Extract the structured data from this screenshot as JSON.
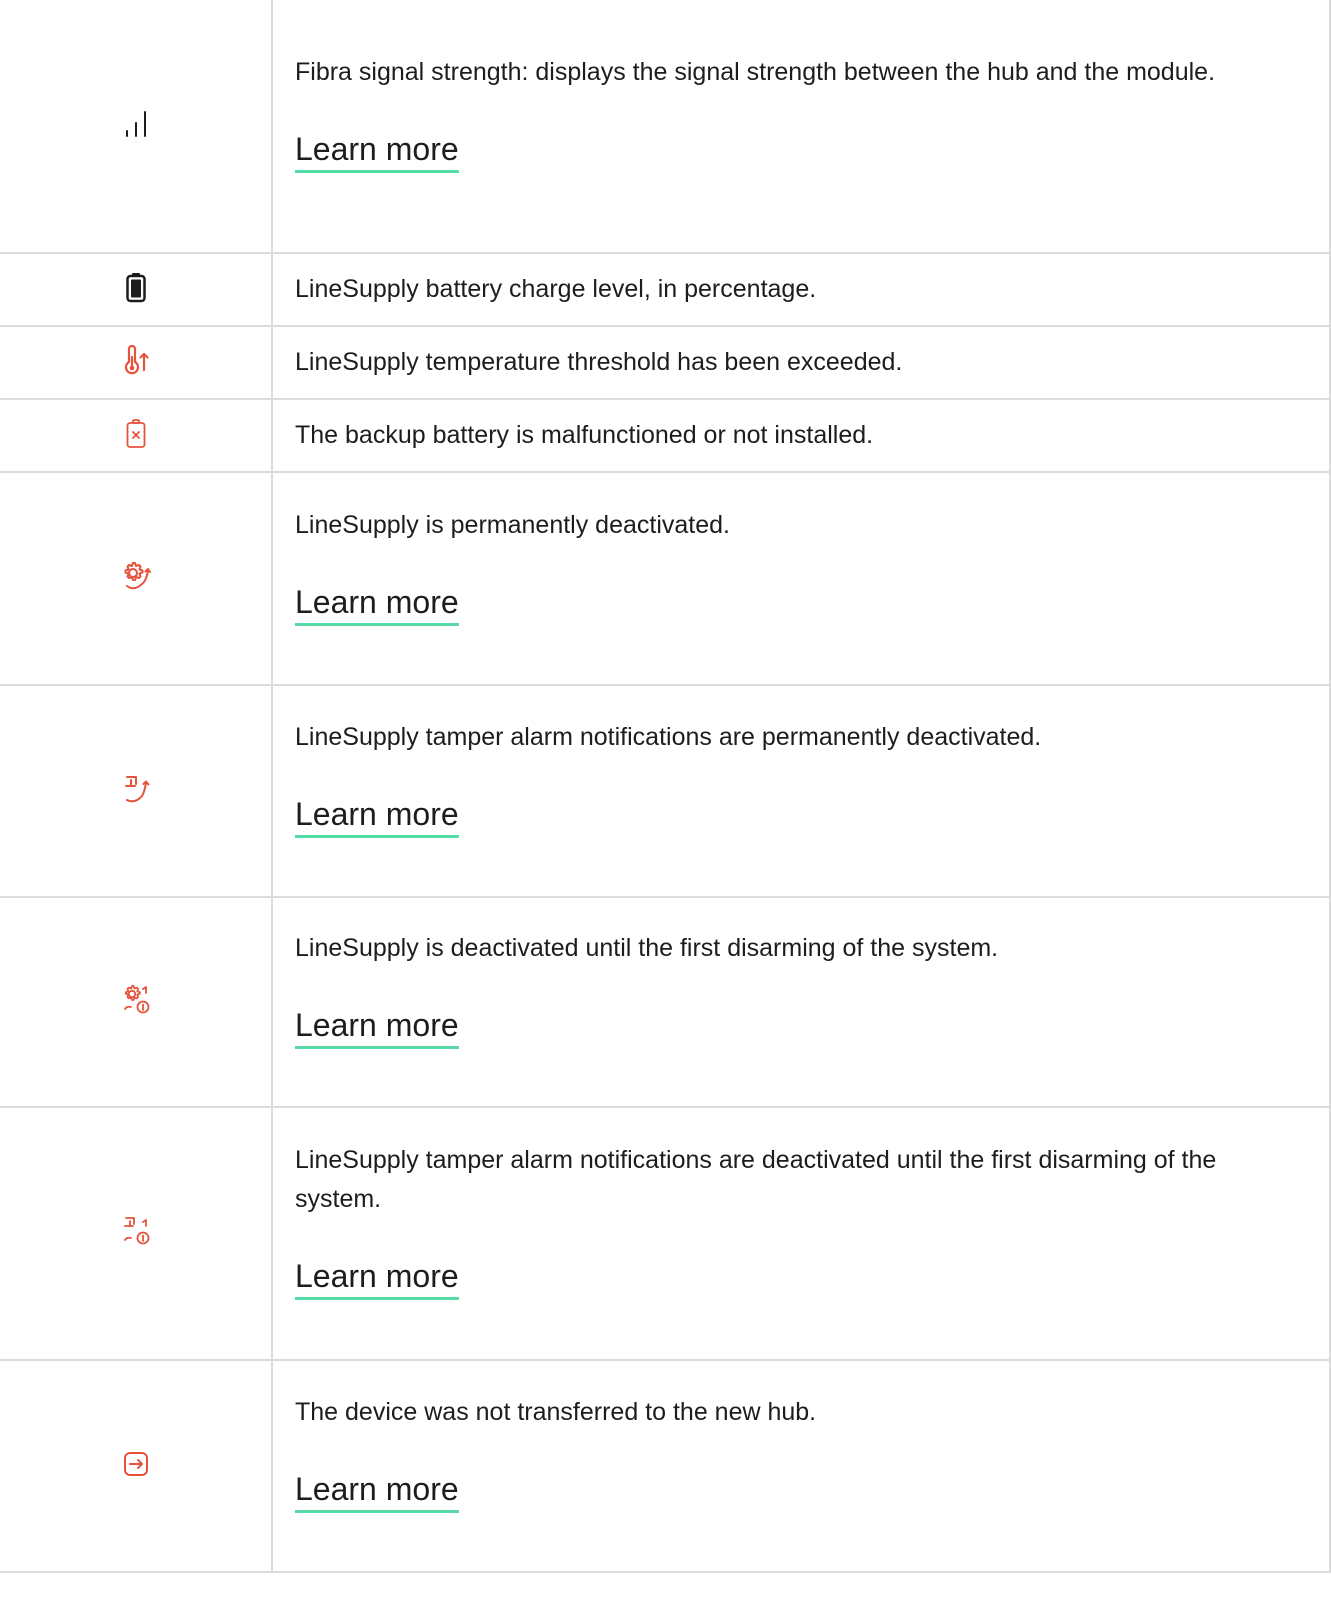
{
  "colors": {
    "accent_underline": "#56dba7",
    "warning_icon": "#e5533d",
    "neutral_icon": "#1d1d1d",
    "grid_line": "#dcdcdc"
  },
  "rows": [
    {
      "icon": "signal-strength-icon",
      "text": "Fibra signal strength: displays the signal strength between the hub and the module.",
      "link": "Learn more"
    },
    {
      "icon": "battery-charge-icon",
      "text": "LineSupply battery charge level, in percentage."
    },
    {
      "icon": "temperature-exceeded-icon",
      "text": "LineSupply temperature threshold has been exceeded."
    },
    {
      "icon": "battery-malfunction-icon",
      "text": "The backup battery is malfunctioned or not installed."
    },
    {
      "icon": "permanently-deactivated-icon",
      "text": "LineSupply is permanently deactivated.",
      "link": "Learn more"
    },
    {
      "icon": "tamper-permanently-deactivated-icon",
      "text": "LineSupply tamper alarm notifications are permanently deactivated.",
      "link": "Learn more"
    },
    {
      "icon": "deactivated-until-disarm-icon",
      "text": "LineSupply is deactivated until the first disarming of the system.",
      "link": "Learn more"
    },
    {
      "icon": "tamper-deactivated-until-disarm-icon",
      "text": "LineSupply tamper alarm notifications are deactivated until the first disarming of the system.",
      "link": "Learn more"
    },
    {
      "icon": "device-not-transferred-icon",
      "text": "The device was not transferred to the new hub.",
      "link": "Learn more"
    }
  ]
}
